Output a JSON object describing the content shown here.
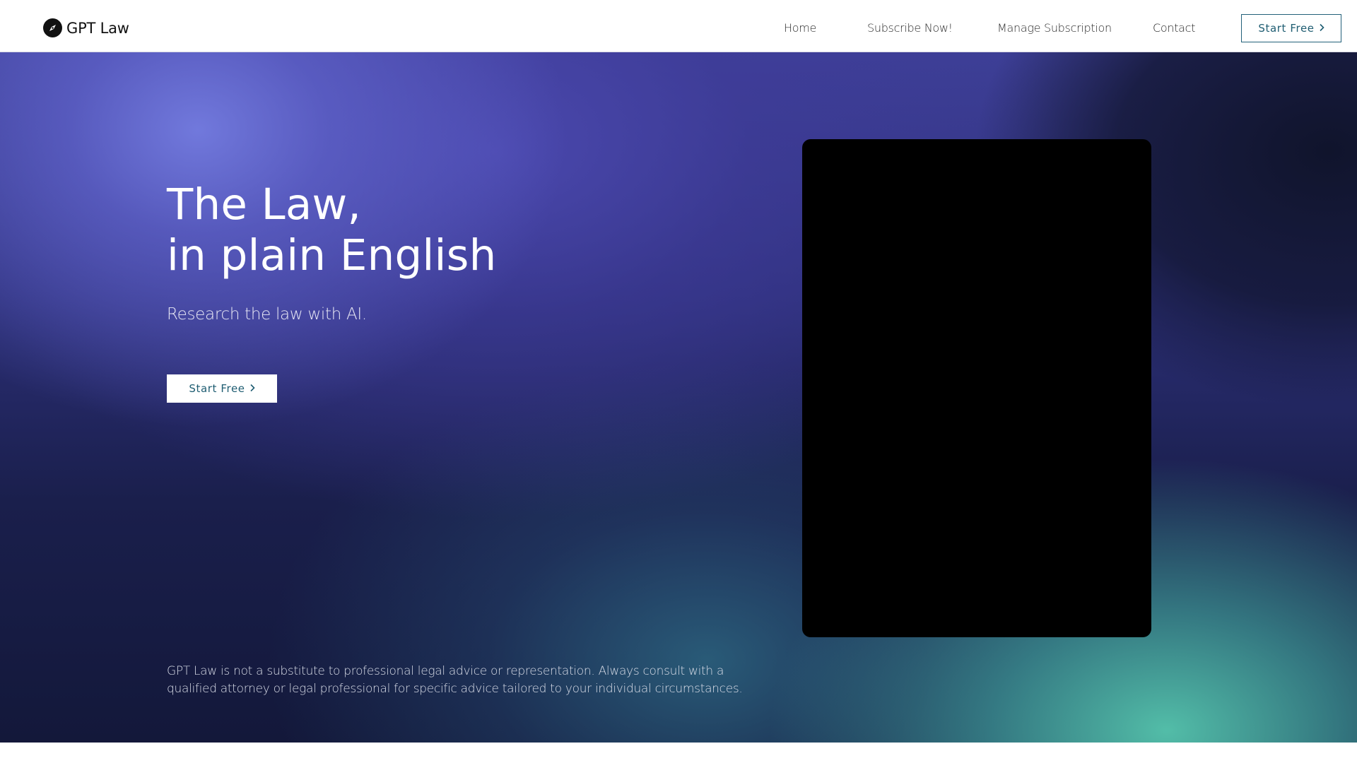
{
  "header": {
    "brand": "GPT Law",
    "nav": [
      {
        "label": "Home"
      },
      {
        "label": "Subscribe Now!"
      },
      {
        "label": "Manage Subscription"
      },
      {
        "label": "Contact"
      }
    ],
    "cta_label": "Start Free",
    "cta_icon": "chevron-right-icon",
    "logo_icon": "compass-icon"
  },
  "hero": {
    "headline_line1": "The Law,",
    "headline_line2": "in plain English",
    "subheadline": "Research the law with AI.",
    "cta_label": "Start Free",
    "cta_icon": "chevron-right-icon",
    "disclaimer": "GPT Law is not a substitute to professional legal advice or representation. Always consult with a qualified attorney or legal professional for specific advice tailored to your individual circumstances."
  },
  "colors": {
    "accent": "#1f5d72",
    "hero_purple": "#3d3f96",
    "hero_teal": "#56c6ae",
    "media_panel": "#000000"
  }
}
